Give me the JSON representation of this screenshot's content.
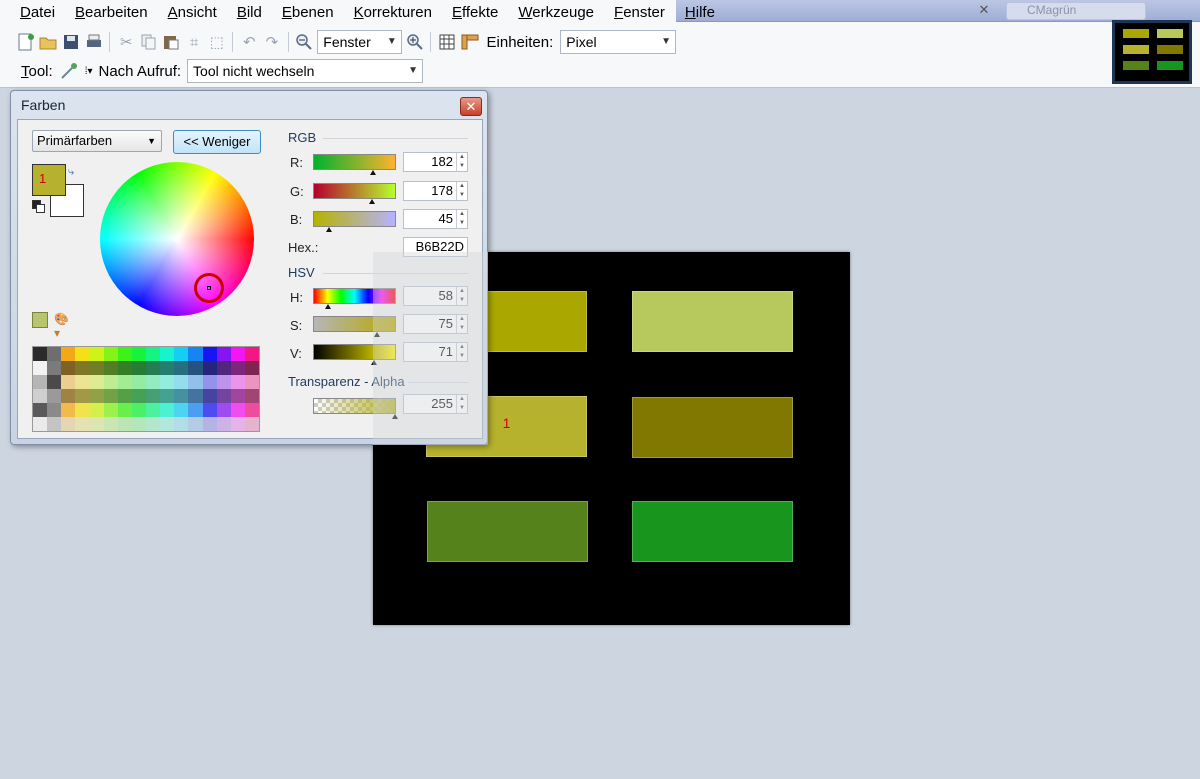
{
  "menu": [
    "Datei",
    "Bearbeiten",
    "Ansicht",
    "Bild",
    "Ebenen",
    "Korrekturen",
    "Effekte",
    "Werkzeuge",
    "Fenster",
    "Hilfe"
  ],
  "title_ghost": "CMagrün",
  "toolbar": {
    "zoom_value": "Fenster",
    "units_label": "Einheiten:",
    "units_value": "Pixel",
    "tool_label": "Tool:",
    "after_label": "Nach Aufruf:",
    "after_value": "Tool nicht wechseln"
  },
  "dialog": {
    "title": "Farben",
    "mode": "Primärfarben",
    "less_button": "<< Weniger",
    "primary_label": "1",
    "rgb_group": "RGB",
    "r_label": "R:",
    "r_value": "182",
    "g_label": "G:",
    "g_value": "178",
    "b_label": "B:",
    "b_value": "45",
    "hex_label": "Hex.:",
    "hex_value": "B6B22D",
    "hsv_group": "HSV",
    "h_label": "H:",
    "h_value": "58",
    "s_label": "S:",
    "s_value": "75",
    "v_label": "V:",
    "v_value": "71",
    "alpha_group": "Transparenz - Alpha",
    "alpha_value": "255"
  },
  "canvas": {
    "rects": [
      {
        "color": "#aaa800",
        "label": ""
      },
      {
        "color": "#b7c85c",
        "label": ""
      },
      {
        "color": "#b6b22d",
        "label": "1"
      },
      {
        "color": "#807800",
        "label": ""
      },
      {
        "color": "#55821a",
        "label": ""
      },
      {
        "color": "#17951c",
        "label": ""
      }
    ]
  },
  "colors": {
    "primary": "#b6b22d",
    "dialog_close": "#c7402a",
    "canvas_bg": "#000000",
    "workspace": "#cdd5e0"
  },
  "icons": [
    "new-image-icon",
    "open-icon",
    "save-icon",
    "print-icon",
    "cut-icon",
    "copy-icon",
    "paste-icon",
    "crop-icon",
    "deselect-icon",
    "undo-icon",
    "redo-icon",
    "zoom-out-icon",
    "zoom-in-icon",
    "grid-icon",
    "ruler-icon",
    "color-picker-icon"
  ]
}
